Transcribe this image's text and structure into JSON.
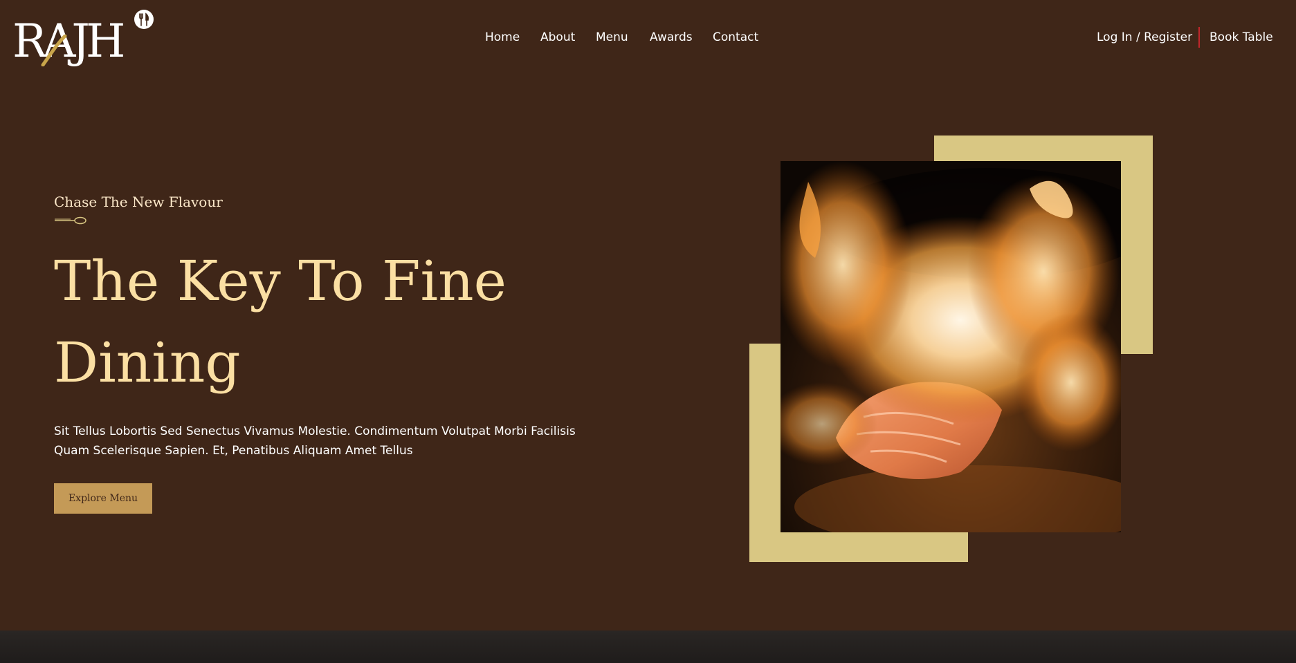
{
  "brand": {
    "logo_text": "RAJH"
  },
  "nav": {
    "links": [
      "Home",
      "About",
      "Menu",
      "Awards",
      "Contact"
    ],
    "login_label": "Log In / Register",
    "book_label": "Book Table"
  },
  "hero": {
    "subtitle": "Chase The New Flavour",
    "title_line1": "The Key To Fine",
    "title_line2": "Dining",
    "description": "Sit Tellus Lobortis Sed Senectus Vivamus Molestie. Condimentum Volutpat Morbi Facilisis Quam Scelerisque Sapien. Et, Penatibus Aliquam Amet Tellus",
    "cta_label": "Explore Menu"
  },
  "colors": {
    "background": "#3f2618",
    "accent_gold": "#d9c783",
    "title_cream": "#fbdfa3",
    "button_gold": "#c49a57",
    "separator_red": "#c0262a"
  },
  "icons": {
    "logo_badge": "fork-knife-icon",
    "divider": "spoon-icon"
  }
}
